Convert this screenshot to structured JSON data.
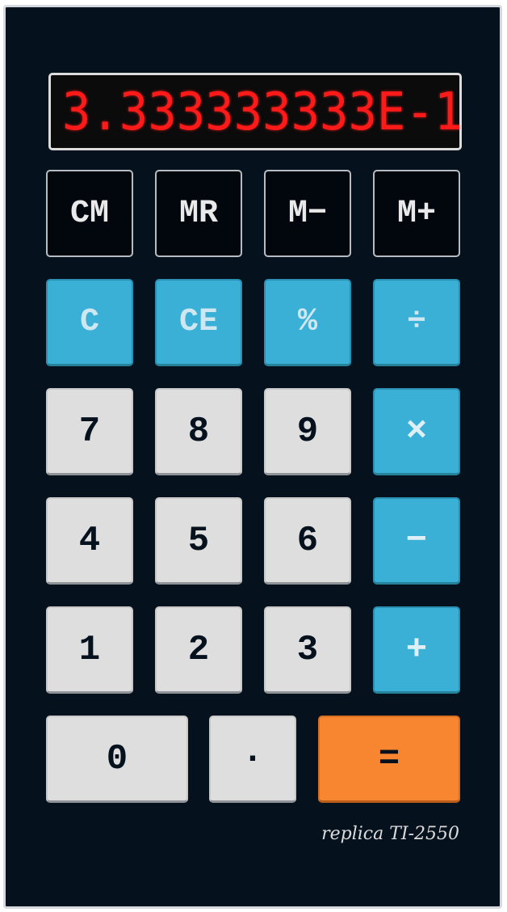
{
  "display": {
    "value": "3.333333333E-1"
  },
  "memory_keys": [
    {
      "label": "CM"
    },
    {
      "label": "MR"
    },
    {
      "label": "M−"
    },
    {
      "label": "M+"
    }
  ],
  "function_keys": [
    {
      "label": "C"
    },
    {
      "label": "CE"
    },
    {
      "label": "%"
    },
    {
      "label": "÷"
    }
  ],
  "digit_keys": {
    "seven": "7",
    "eight": "8",
    "nine": "9",
    "four": "4",
    "five": "5",
    "six": "6",
    "one": "1",
    "two": "2",
    "three": "3",
    "zero": "0",
    "point": "·"
  },
  "operator_keys": {
    "multiply": "×",
    "subtract": "−",
    "add": "+",
    "equals": "="
  },
  "footer": {
    "text": "replica TI-2550"
  },
  "colors": {
    "body": "#06111e",
    "display_text": "#ff1a1a",
    "function_key": "#3ab0d6",
    "number_key": "#dedede",
    "equals_key": "#f8852f"
  }
}
